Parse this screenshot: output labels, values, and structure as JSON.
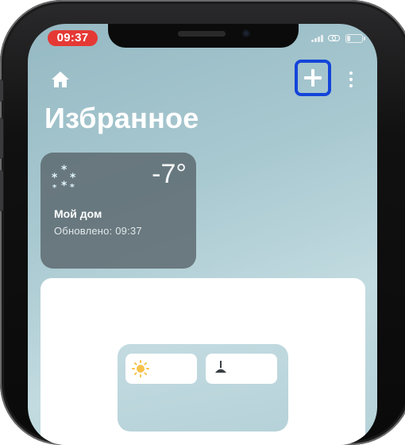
{
  "status_bar": {
    "time": "09:37",
    "time_badge_color": "#e53935",
    "icons": [
      "signal-icon",
      "link-icon",
      "battery-icon"
    ]
  },
  "header": {
    "home_icon": "home-icon",
    "add_icon": "plus-icon",
    "more_icon": "more-vertical-icon",
    "highlight_color": "#1445d9"
  },
  "page": {
    "title": "Избранное"
  },
  "weather_card": {
    "icon": "snow-icon",
    "temperature": "-7°",
    "home_name": "Мой дом",
    "updated": "Обновлено: 09:37"
  },
  "device_preview": {
    "tiles": [
      {
        "icon": "sun-icon"
      },
      {
        "icon": "lamp-icon"
      }
    ]
  }
}
